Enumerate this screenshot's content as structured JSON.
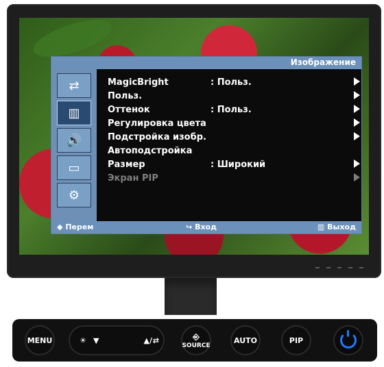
{
  "osd": {
    "title": "Изображение",
    "menu": [
      {
        "label": "MagicBright",
        "value": ": Польз.",
        "has_arrow": true,
        "enabled": true
      },
      {
        "label": "Польз.",
        "value": "",
        "has_arrow": true,
        "enabled": true
      },
      {
        "label": "Оттенок",
        "value": ": Польз.",
        "has_arrow": true,
        "enabled": true
      },
      {
        "label": "Регулировка цвета",
        "value": "",
        "has_arrow": true,
        "enabled": true
      },
      {
        "label": "Подстройка изобр.",
        "value": "",
        "has_arrow": true,
        "enabled": true
      },
      {
        "label": "Автоподстройка",
        "value": "",
        "has_arrow": false,
        "enabled": true
      },
      {
        "label": "Размер",
        "value": ": Широкий",
        "has_arrow": true,
        "enabled": true
      },
      {
        "label": "Экран PIP",
        "value": "",
        "has_arrow": true,
        "enabled": false
      }
    ],
    "footer": {
      "left": "Перем",
      "center": "Вход",
      "right": "Выход"
    },
    "side_icons": [
      "input-icon",
      "picture-icon",
      "sound-icon",
      "pip-icon",
      "settings-icon"
    ],
    "active_side_index": 1
  },
  "buttons": {
    "menu": "MENU",
    "brightness_down": "▼",
    "brightness_up": "▲/",
    "source": "SOURCE",
    "auto": "AUTO",
    "pip": "PIP"
  },
  "colors": {
    "osd_blue": "#6b90b9",
    "power_blue": "#1f7bff"
  }
}
